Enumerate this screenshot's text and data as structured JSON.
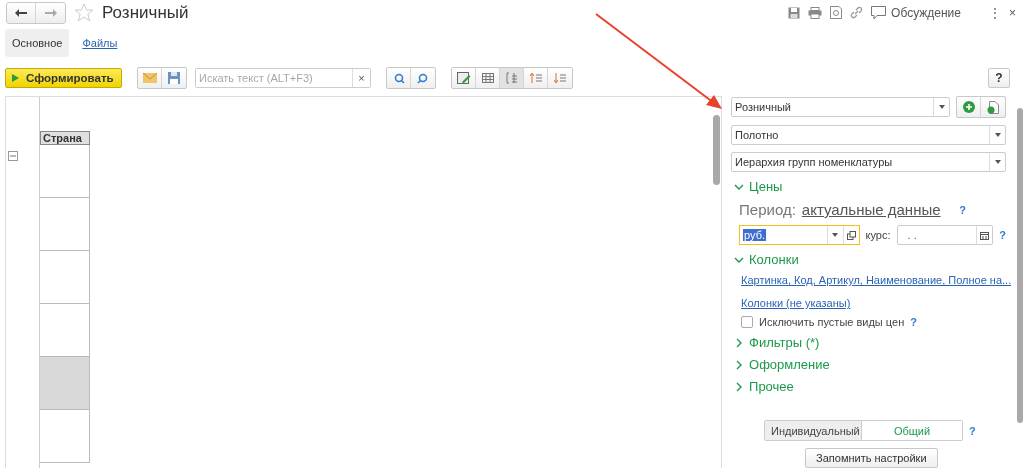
{
  "window": {
    "title": "Розничный",
    "favorite": false,
    "menu": "⋮",
    "close": "×"
  },
  "header_actions": {
    "discussion": "Обсуждение"
  },
  "tabs": [
    {
      "label": "Основное",
      "selected": true
    },
    {
      "label": "Файлы",
      "selected": false
    }
  ],
  "toolbar": {
    "generate": "Сформировать",
    "search": {
      "placeholder": "Искать текст (ALT+F3)"
    },
    "clear": "×",
    "help": "?"
  },
  "report": {
    "column_header": "Страна",
    "rows": [
      {
        "shaded": false
      },
      {
        "shaded": false
      },
      {
        "shaded": false
      },
      {
        "shaded": false
      },
      {
        "shaded": true
      },
      {
        "shaded": false
      }
    ]
  },
  "settings": {
    "variant": "Розничный",
    "mode": "Полотно",
    "grouping": "Иерархия групп номенклатуры",
    "prices": {
      "title": "Цены",
      "expanded": true,
      "period_label": "Период:",
      "period_value": "актуальные данные",
      "help": "?",
      "currency": "руб.",
      "rate_label": "курс:",
      "rate_value": ". .",
      "rate_help": "?"
    },
    "columns": {
      "title": "Колонки",
      "expanded": true,
      "links": [
        "Картинка, Код, Артикул, Наименование, Полное на...",
        "Колонки (не указаны)"
      ],
      "exclude_empty": {
        "label": "Исключить пустые виды цен",
        "checked": false,
        "help": "?"
      }
    },
    "sections": [
      {
        "title": "Фильтры (*)",
        "expanded": false
      },
      {
        "title": "Оформление",
        "expanded": false
      },
      {
        "title": "Прочее",
        "expanded": false
      }
    ],
    "scope": [
      {
        "label": "Индивидуальный",
        "selected": false
      },
      {
        "label": "Общий",
        "selected": true
      }
    ],
    "scope_help": "?",
    "save": "Запомнить настройки"
  }
}
